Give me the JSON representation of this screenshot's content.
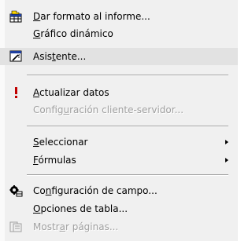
{
  "menu": {
    "items": [
      {
        "pre": "",
        "mn": "D",
        "post": "ar formato al informe...",
        "icon": "format-report-icon",
        "enabled": true
      },
      {
        "pre": "",
        "mn": "G",
        "post": "ráfico dinámico",
        "icon": "",
        "enabled": true
      },
      {
        "pre": "Asis",
        "mn": "t",
        "post": "ente...",
        "icon": "wizard-icon",
        "enabled": true
      },
      {
        "pre": "",
        "mn": "A",
        "post": "ctualizar datos",
        "icon": "refresh-exclamation-icon",
        "enabled": true
      },
      {
        "pre": "Config",
        "mn": "u",
        "post": "ración cliente-servidor...",
        "icon": "",
        "enabled": false
      },
      {
        "pre": "",
        "mn": "S",
        "post": "eleccionar",
        "icon": "",
        "enabled": true,
        "submenu": true
      },
      {
        "pre": "",
        "mn": "F",
        "post": "órmulas",
        "icon": "",
        "enabled": true,
        "submenu": true
      },
      {
        "pre": "Co",
        "mn": "n",
        "post": "figuración de campo...",
        "icon": "field-settings-icon",
        "enabled": true
      },
      {
        "pre": "",
        "mn": "O",
        "post": "pciones de tabla...",
        "icon": "",
        "enabled": true
      },
      {
        "pre": "Mostr",
        "mn": "a",
        "post": "r páginas...",
        "icon": "show-pages-icon",
        "enabled": false
      }
    ]
  }
}
